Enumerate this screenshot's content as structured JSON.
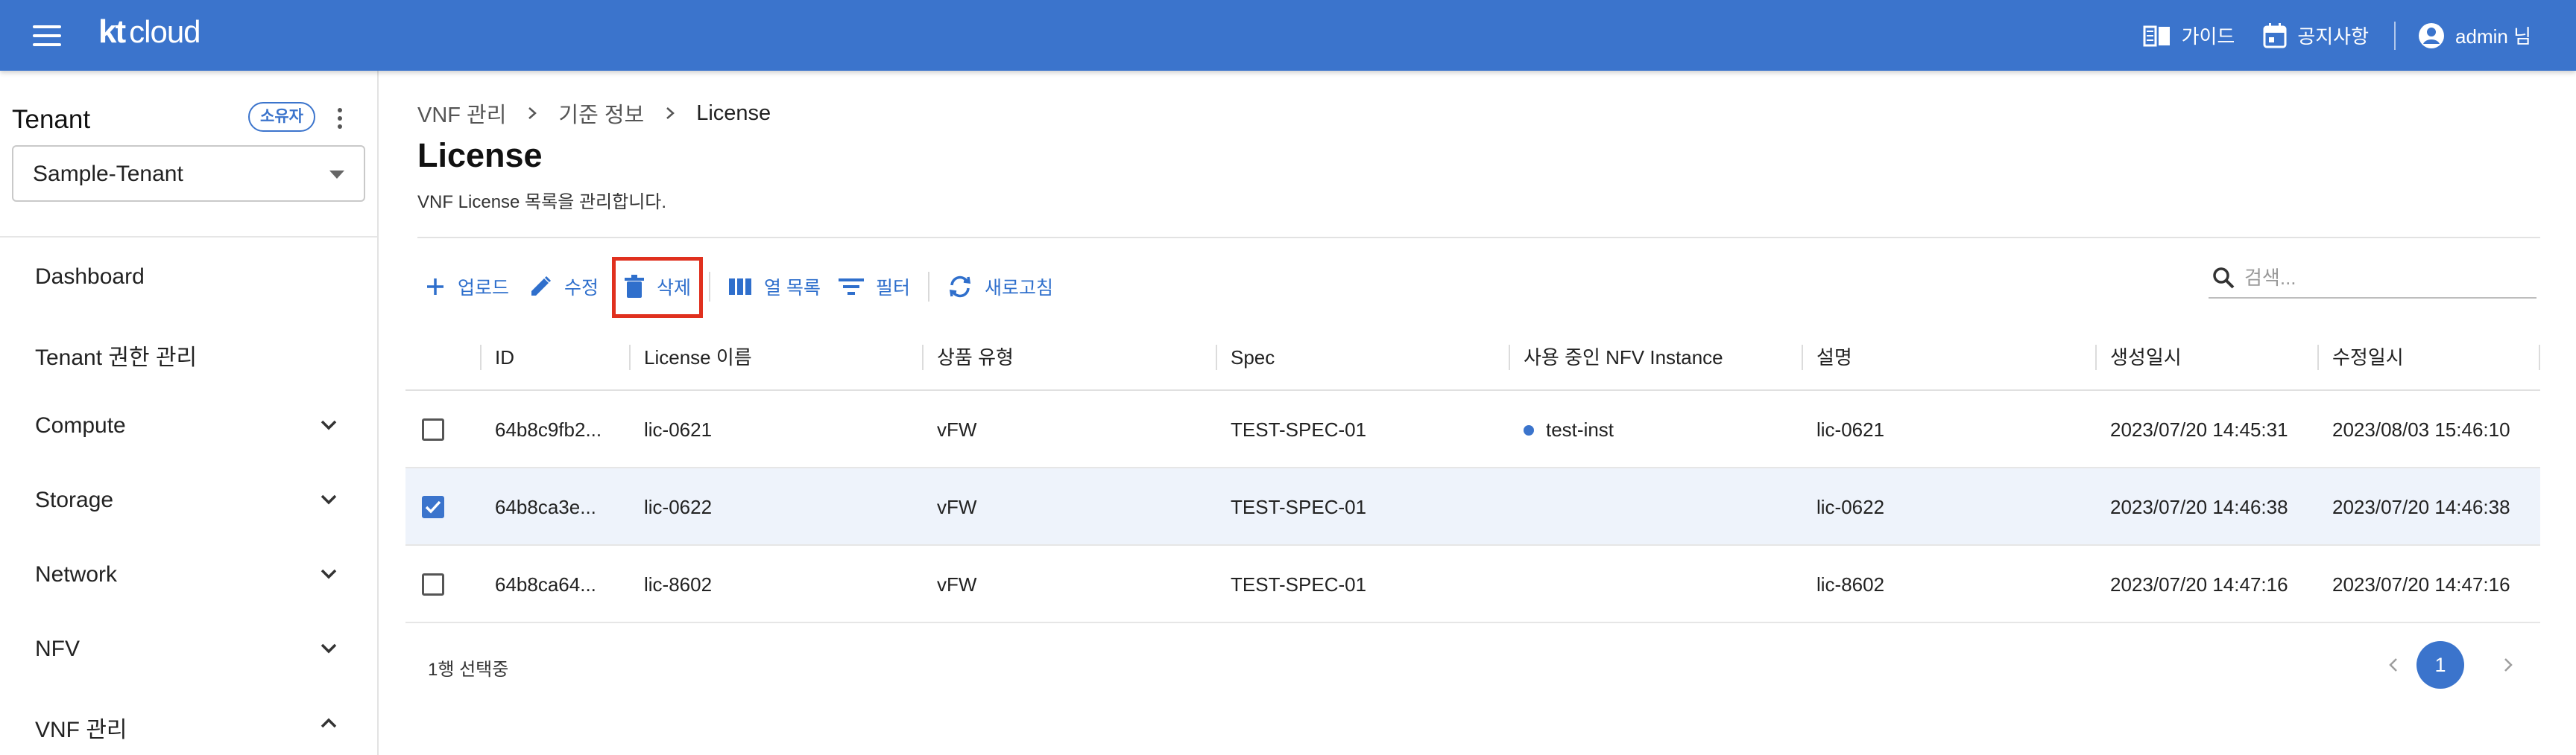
{
  "app": {
    "logo_main": "kt",
    "logo_sub": "cloud",
    "guide_label": "가이드",
    "notice_label": "공지사항",
    "user_label": "admin 님"
  },
  "sidebar": {
    "tenant_title": "Tenant",
    "owner_badge": "소유자",
    "tenant_selected": "Sample-Tenant",
    "items": [
      {
        "label": "Dashboard",
        "expandable": false
      },
      {
        "label": "Tenant 권한 관리",
        "expandable": false
      },
      {
        "label": "Compute",
        "expandable": true,
        "expanded": false
      },
      {
        "label": "Storage",
        "expandable": true,
        "expanded": false
      },
      {
        "label": "Network",
        "expandable": true,
        "expanded": false
      },
      {
        "label": "NFV",
        "expandable": true,
        "expanded": false
      },
      {
        "label": "VNF 관리",
        "expandable": true,
        "expanded": true
      }
    ]
  },
  "breadcrumb": [
    "VNF 관리",
    "기준 정보",
    "License"
  ],
  "page": {
    "title": "License",
    "description": "VNF License 목록을 관리합니다."
  },
  "toolbar": {
    "upload_label": "업로드",
    "edit_label": "수정",
    "delete_label": "삭제",
    "columns_label": "열 목록",
    "filter_label": "필터",
    "refresh_label": "새로고침"
  },
  "search": {
    "placeholder": "검색...",
    "value": ""
  },
  "table": {
    "columns": [
      "ID",
      "License 이름",
      "상품 유형",
      "Spec",
      "사용 중인 NFV Instance",
      "설명",
      "생성일시",
      "수정일시"
    ],
    "rows": [
      {
        "checked": false,
        "id": "64b8c9fb2...",
        "name": "lic-0621",
        "type": "vFW",
        "spec": "TEST-SPEC-01",
        "instance": "test-inst",
        "desc": "lic-0621",
        "created": "2023/07/20 14:45:31",
        "updated": "2023/08/03 15:46:10"
      },
      {
        "checked": true,
        "id": "64b8ca3e...",
        "name": "lic-0622",
        "type": "vFW",
        "spec": "TEST-SPEC-01",
        "instance": "",
        "desc": "lic-0622",
        "created": "2023/07/20 14:46:38",
        "updated": "2023/07/20 14:46:38"
      },
      {
        "checked": false,
        "id": "64b8ca64...",
        "name": "lic-8602",
        "type": "vFW",
        "spec": "TEST-SPEC-01",
        "instance": "",
        "desc": "lic-8602",
        "created": "2023/07/20 14:47:16",
        "updated": "2023/07/20 14:47:16"
      }
    ],
    "selection_text": "1행 선택중"
  },
  "pagination": {
    "current_page": "1"
  },
  "colors": {
    "primary": "#3b74cc",
    "highlight_border": "#e0301e",
    "selected_row": "#eef3fb"
  }
}
